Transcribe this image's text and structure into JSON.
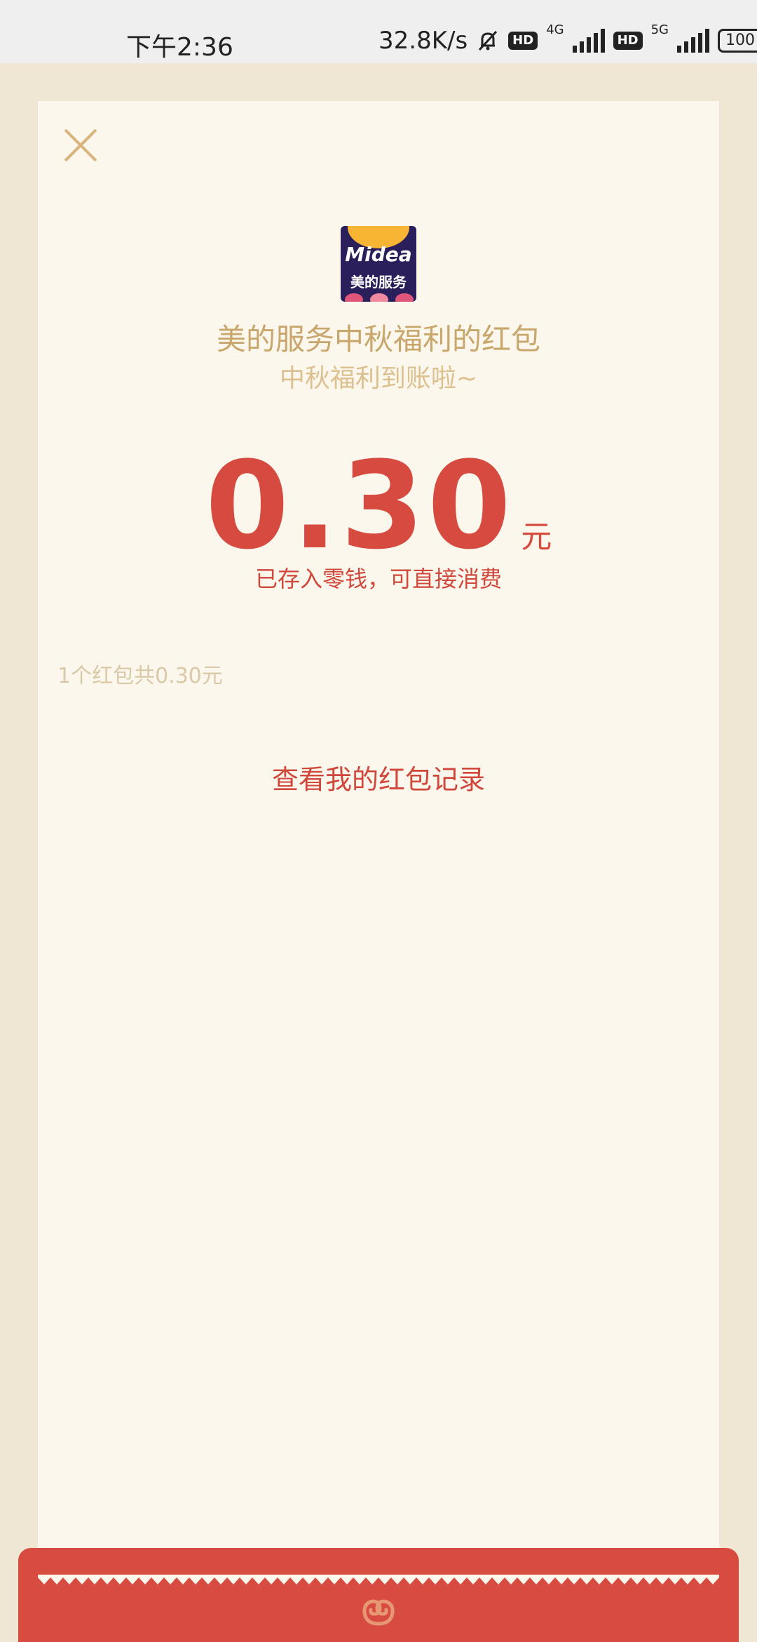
{
  "status_bar": {
    "time": "下午2:36",
    "net_speed": "32.8K/s",
    "hd_label": "HD",
    "net_4g": "4G",
    "net_5g": "5G",
    "battery": "100"
  },
  "header": {
    "logo_brand": "Midea",
    "logo_sub": "美的服务",
    "title": "美的服务中秋福利的红包",
    "subtitle": "中秋福利到账啦~"
  },
  "amount": {
    "value": "0.30",
    "unit": "元",
    "note": "已存入零钱，可直接消费"
  },
  "summary": "1个红包共0.30元",
  "records_link": "查看我的红包记录",
  "colors": {
    "accent_red": "#d64a40",
    "gold": "#c9a66b",
    "card_bg": "#fbf7ec",
    "page_bg": "#efe6d3"
  },
  "icons": [
    "bell-muted-icon",
    "signal-icon",
    "battery-icon",
    "close-icon",
    "swirl-icon"
  ]
}
